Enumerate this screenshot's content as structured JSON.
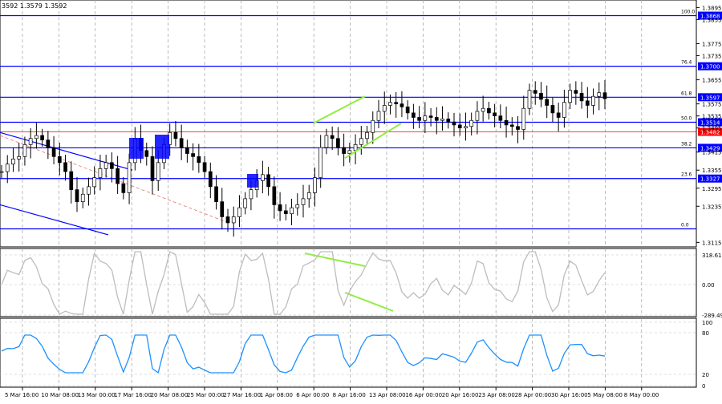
{
  "header_text": "3592 1.3579 1.3592",
  "price_axis": {
    "ticks": [
      "1.3895",
      "1.3855",
      "1.3775",
      "1.3735",
      "1.3655",
      "1.3575",
      "1.3535",
      "1.3495",
      "1.3415",
      "1.3355",
      "1.3295",
      "1.3235",
      "1.3115"
    ],
    "tick_values": [
      1.3895,
      1.3855,
      1.3775,
      1.3735,
      1.3655,
      1.3575,
      1.3535,
      1.3495,
      1.3415,
      1.3355,
      1.3295,
      1.3235,
      1.3115
    ],
    "ylim": [
      1.31,
      1.392
    ]
  },
  "fib_levels": [
    {
      "label": "100.0",
      "price_tag": "1.3868",
      "value": 1.3868
    },
    {
      "label": "76.4",
      "price_tag": "1.3700",
      "value": 1.37
    },
    {
      "label": "61.8",
      "price_tag": "1.3597",
      "value": 1.3597
    },
    {
      "label": "50.0",
      "price_tag": "1.3514",
      "value": 1.3514
    },
    {
      "label": "38.2",
      "price_tag": "1.3429",
      "value": 1.3429
    },
    {
      "label": "23.6",
      "price_tag": "1.3327",
      "value": 1.3327
    },
    {
      "label": "0.0",
      "price_tag": "",
      "value": 1.316
    }
  ],
  "current_price": {
    "price_tag": "1.3482",
    "value": 1.3482
  },
  "cci_panel": {
    "ticks": [
      "318.6161",
      "0.00",
      "-289.493"
    ]
  },
  "rsi_panel": {
    "ticks": [
      "100",
      "80",
      "20",
      "0"
    ]
  },
  "x_axis": {
    "labels": [
      "5 Mar 16:00",
      "10 Mar 08:00",
      "13 Mar 00:00",
      "17 Mar 16:00",
      "20 Mar 08:00",
      "25 Mar 00:00",
      "27 Mar 16:00",
      "1 Apr 08:00",
      "6 Apr 00:00",
      "8 Apr 16:00",
      "13 Apr 08:00",
      "16 Apr 00:00",
      "20 Apr 16:00",
      "23 Apr 08:00",
      "28 Apr 00:00",
      "30 Apr 16:00",
      "5 May 08:00",
      "8 May 00:00"
    ]
  },
  "colors": {
    "level_line": "#0000ff",
    "current_line": "#ff0000",
    "tag_fill": "#0000ff",
    "tag_text": "#ffffff",
    "current_tag_fill": "#ff0000",
    "candle": "#000000",
    "pattern_line": "#90ee40",
    "oscillator": "#bdbdbd",
    "rsi": "#1e90ff",
    "box": "#0000ff",
    "channel_dash": "#e07070"
  },
  "chart_data": {
    "type": "line",
    "series": [
      {
        "values": [
          1.335,
          1.3375,
          1.3392,
          1.34,
          1.344,
          1.346,
          1.347,
          1.3455,
          1.343,
          1.34,
          1.338,
          1.335,
          1.329,
          1.325,
          1.3275,
          1.33,
          1.333,
          1.336,
          1.338,
          1.336,
          1.331,
          1.328,
          1.338,
          1.346,
          1.342,
          1.34,
          1.332,
          1.338,
          1.344,
          1.348,
          1.346,
          1.343,
          1.341,
          1.34,
          1.338,
          1.335,
          1.33,
          1.325,
          1.32,
          1.318,
          1.32,
          1.323,
          1.326,
          1.329,
          1.332,
          1.334,
          1.33,
          1.324,
          1.322,
          1.321,
          1.323,
          1.324,
          1.326,
          1.328,
          1.333,
          1.343,
          1.347,
          1.346,
          1.343,
          1.341,
          1.342,
          1.344,
          1.346,
          1.348,
          1.352,
          1.355,
          1.357,
          1.358,
          1.3575,
          1.3565,
          1.3545,
          1.353,
          1.352,
          1.3535,
          1.353,
          1.352,
          1.3525,
          1.3515,
          1.3505,
          1.3495,
          1.35,
          1.352,
          1.355,
          1.356,
          1.3545,
          1.3535,
          1.352,
          1.3505,
          1.35,
          1.349,
          1.356,
          1.362,
          1.361,
          1.359,
          1.357,
          1.3545,
          1.353,
          1.358,
          1.362,
          1.361,
          1.3585,
          1.357,
          1.36,
          1.3612,
          1.3592
        ]
      }
    ],
    "xlim": [
      "5 Mar 16:00",
      "8 May 00:00"
    ],
    "ylim": [
      1.31,
      1.392
    ],
    "grid": true
  }
}
